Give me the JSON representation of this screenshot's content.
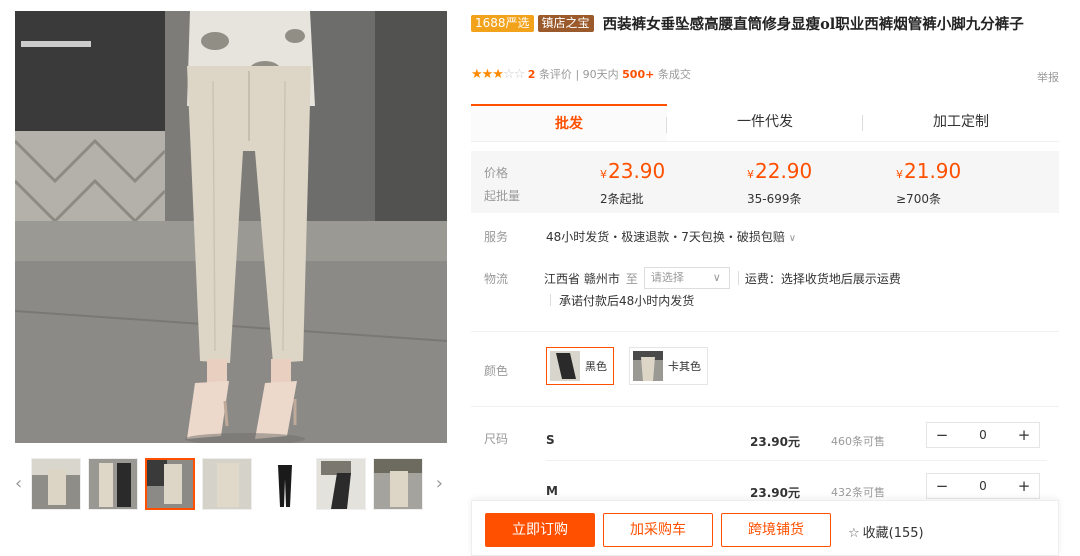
{
  "title": {
    "tag_1688": "1688严选",
    "tag_shop": "镇店之宝",
    "text": "西装裤女垂坠感高腰直筒修身显瘦ol职业西裤烟管裤小脚九分裤子"
  },
  "rating": {
    "stars_filled": 3,
    "stars_total": 5,
    "review_count": "2",
    "review_label": "条评价",
    "sep": "|",
    "period": "90天内",
    "sales": "500+",
    "sales_label": "条成交",
    "report": "举报"
  },
  "tabs": [
    {
      "label": "批发",
      "active": true
    },
    {
      "label": "一件代发",
      "active": false
    },
    {
      "label": "加工定制",
      "active": false
    }
  ],
  "pricing": {
    "price_label": "价格",
    "qty_label": "起批量",
    "currency": "¥",
    "tiers": [
      {
        "price": "23.90",
        "qty": "2条起批"
      },
      {
        "price": "22.90",
        "qty": "35-699条"
      },
      {
        "price": "21.90",
        "qty": "≥700条"
      }
    ]
  },
  "service": {
    "label": "服务",
    "text": "48小时发货・极速退款・7天包换・破损包赔",
    "dropdown": "∨"
  },
  "logistics": {
    "label": "物流",
    "origin": "江西省 赣州市",
    "to": "至",
    "select_placeholder": "请选择",
    "shipping": "运费：选择收货地后展示运费",
    "promise": "承诺付款后48小时内发货"
  },
  "color": {
    "label": "颜色",
    "options": [
      {
        "name": "黑色",
        "selected": true
      },
      {
        "name": "卡其色",
        "selected": false
      }
    ]
  },
  "size": {
    "label": "尺码",
    "rows": [
      {
        "name": "S",
        "price": "23.90元",
        "stock": "460条可售",
        "qty": "0"
      },
      {
        "name": "M",
        "price": "23.90元",
        "stock": "432条可售",
        "qty": "0"
      }
    ]
  },
  "actions": {
    "buy_now": "立即订购",
    "add_cart": "加采购车",
    "cross_border": "跨境铺货",
    "favorite": "收藏(155)"
  },
  "colors": {
    "accent": "#ff5000",
    "tag_yellow": "#f3a21b",
    "tag_brown": "#9b5a2b",
    "star": "#ff8a00"
  },
  "icons": {
    "prev": "‹",
    "next": "›",
    "minus": "−",
    "plus": "+",
    "chevron": "∨",
    "star_outline": "☆"
  }
}
